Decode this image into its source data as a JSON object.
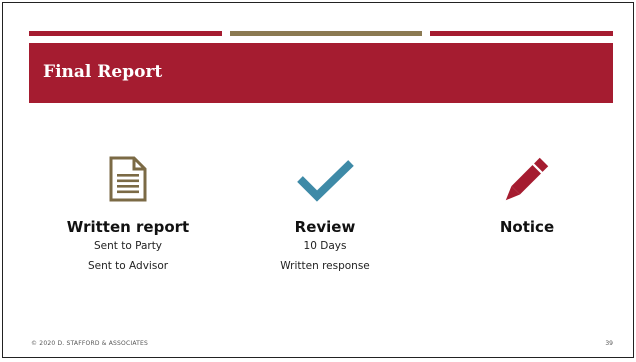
{
  "slide": {
    "title": "Final Report",
    "colors": {
      "accent": "#a51c30",
      "olive": "#8b7a52",
      "check": "#3e8aa7",
      "doc_icon": "#7b6a45"
    },
    "columns": [
      {
        "icon": "document-icon",
        "heading": "Written report",
        "lines": [
          "Sent to Party",
          "Sent to Advisor"
        ]
      },
      {
        "icon": "checkmark-icon",
        "heading": "Review",
        "lines": [
          "10 Days",
          "Written response"
        ]
      },
      {
        "icon": "pencil-icon",
        "heading": "Notice",
        "lines": []
      }
    ],
    "footer": "© 2020 D. STAFFORD & ASSOCIATES",
    "page_number": "39"
  }
}
